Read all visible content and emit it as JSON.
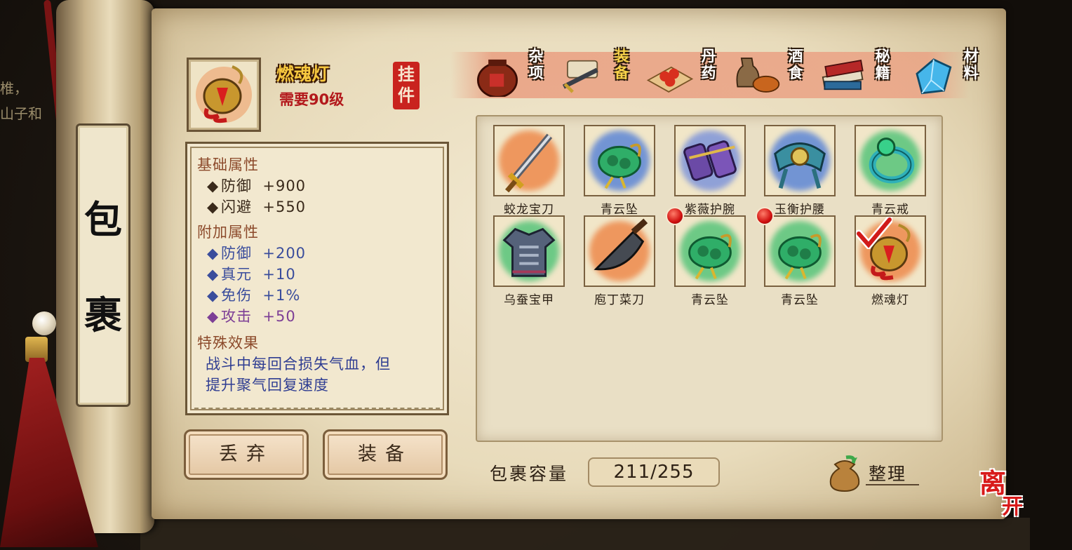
{
  "background_text": [
    "椎，",
    "山子和"
  ],
  "side_title": [
    "包",
    "裹"
  ],
  "selected_item": {
    "name": "燃魂灯",
    "level_req": "需要90级",
    "category_seal": "挂件",
    "icon": "lantern-icon"
  },
  "attributes": {
    "base_header": "基础属性",
    "base": [
      {
        "name": "防御",
        "value": "+900"
      },
      {
        "name": "闪避",
        "value": "+550"
      }
    ],
    "extra_header": "附加属性",
    "extra": [
      {
        "name": "防御",
        "value": "+200",
        "color": "#3a4d9c"
      },
      {
        "name": "真元",
        "value": "+10",
        "color": "#3a4d9c"
      },
      {
        "name": "免伤",
        "value": "+1%",
        "color": "#3a4d9c"
      },
      {
        "name": "攻击",
        "value": "+50",
        "color": "#7d3f96"
      }
    ],
    "special_header": "特殊效果",
    "special_lines": [
      "战斗中每回合损失气血，但",
      "提升聚气回复速度"
    ],
    "diamond": "◆"
  },
  "buttons": {
    "discard": "丢弃",
    "equip": "装备"
  },
  "tabs": [
    {
      "label": "杂项",
      "icon": "jar-icon",
      "active": false
    },
    {
      "label": "装备",
      "icon": "scroll-equip-icon",
      "active": true
    },
    {
      "label": "丹药",
      "icon": "pills-icon",
      "active": false
    },
    {
      "label": "酒食",
      "icon": "wine-food-icon",
      "active": false
    },
    {
      "label": "秘籍",
      "icon": "books-icon",
      "active": false
    },
    {
      "label": "材料",
      "icon": "crystal-icon",
      "active": false
    }
  ],
  "inventory": [
    {
      "name": "蛟龙宝刀",
      "icon": "sword-icon",
      "glow": "#ee8a4c",
      "new": false,
      "equipped": false
    },
    {
      "name": "青云坠",
      "icon": "jade-pendant-icon",
      "glow": "#5d86d6",
      "new": false,
      "equipped": false
    },
    {
      "name": "紫薇护腕",
      "icon": "bracer-icon",
      "glow": "#7f95da",
      "new": false,
      "equipped": false
    },
    {
      "name": "玉衡护腰",
      "icon": "belt-icon",
      "glow": "#5d86d6",
      "new": false,
      "equipped": false
    },
    {
      "name": "青云戒",
      "icon": "ring-icon",
      "glow": "#56c47a",
      "new": false,
      "equipped": false
    },
    {
      "name": "乌蚕宝甲",
      "icon": "armor-icon",
      "glow": "#56c47a",
      "new": false,
      "equipped": false
    },
    {
      "name": "庖丁菜刀",
      "icon": "cleaver-icon",
      "glow": "#ee8a4c",
      "new": false,
      "equipped": false
    },
    {
      "name": "青云坠",
      "icon": "jade-pendant-icon",
      "glow": "#56c47a",
      "new": true,
      "equipped": false
    },
    {
      "name": "青云坠",
      "icon": "jade-pendant-icon",
      "glow": "#56c47a",
      "new": true,
      "equipped": false
    },
    {
      "name": "燃魂灯",
      "icon": "lantern-icon",
      "glow": "#ee8a4c",
      "new": false,
      "equipped": true
    }
  ],
  "capacity": {
    "label": "包裹容量",
    "value": "211/255"
  },
  "sort_label": "整理",
  "leave_label": [
    "离",
    "开"
  ]
}
